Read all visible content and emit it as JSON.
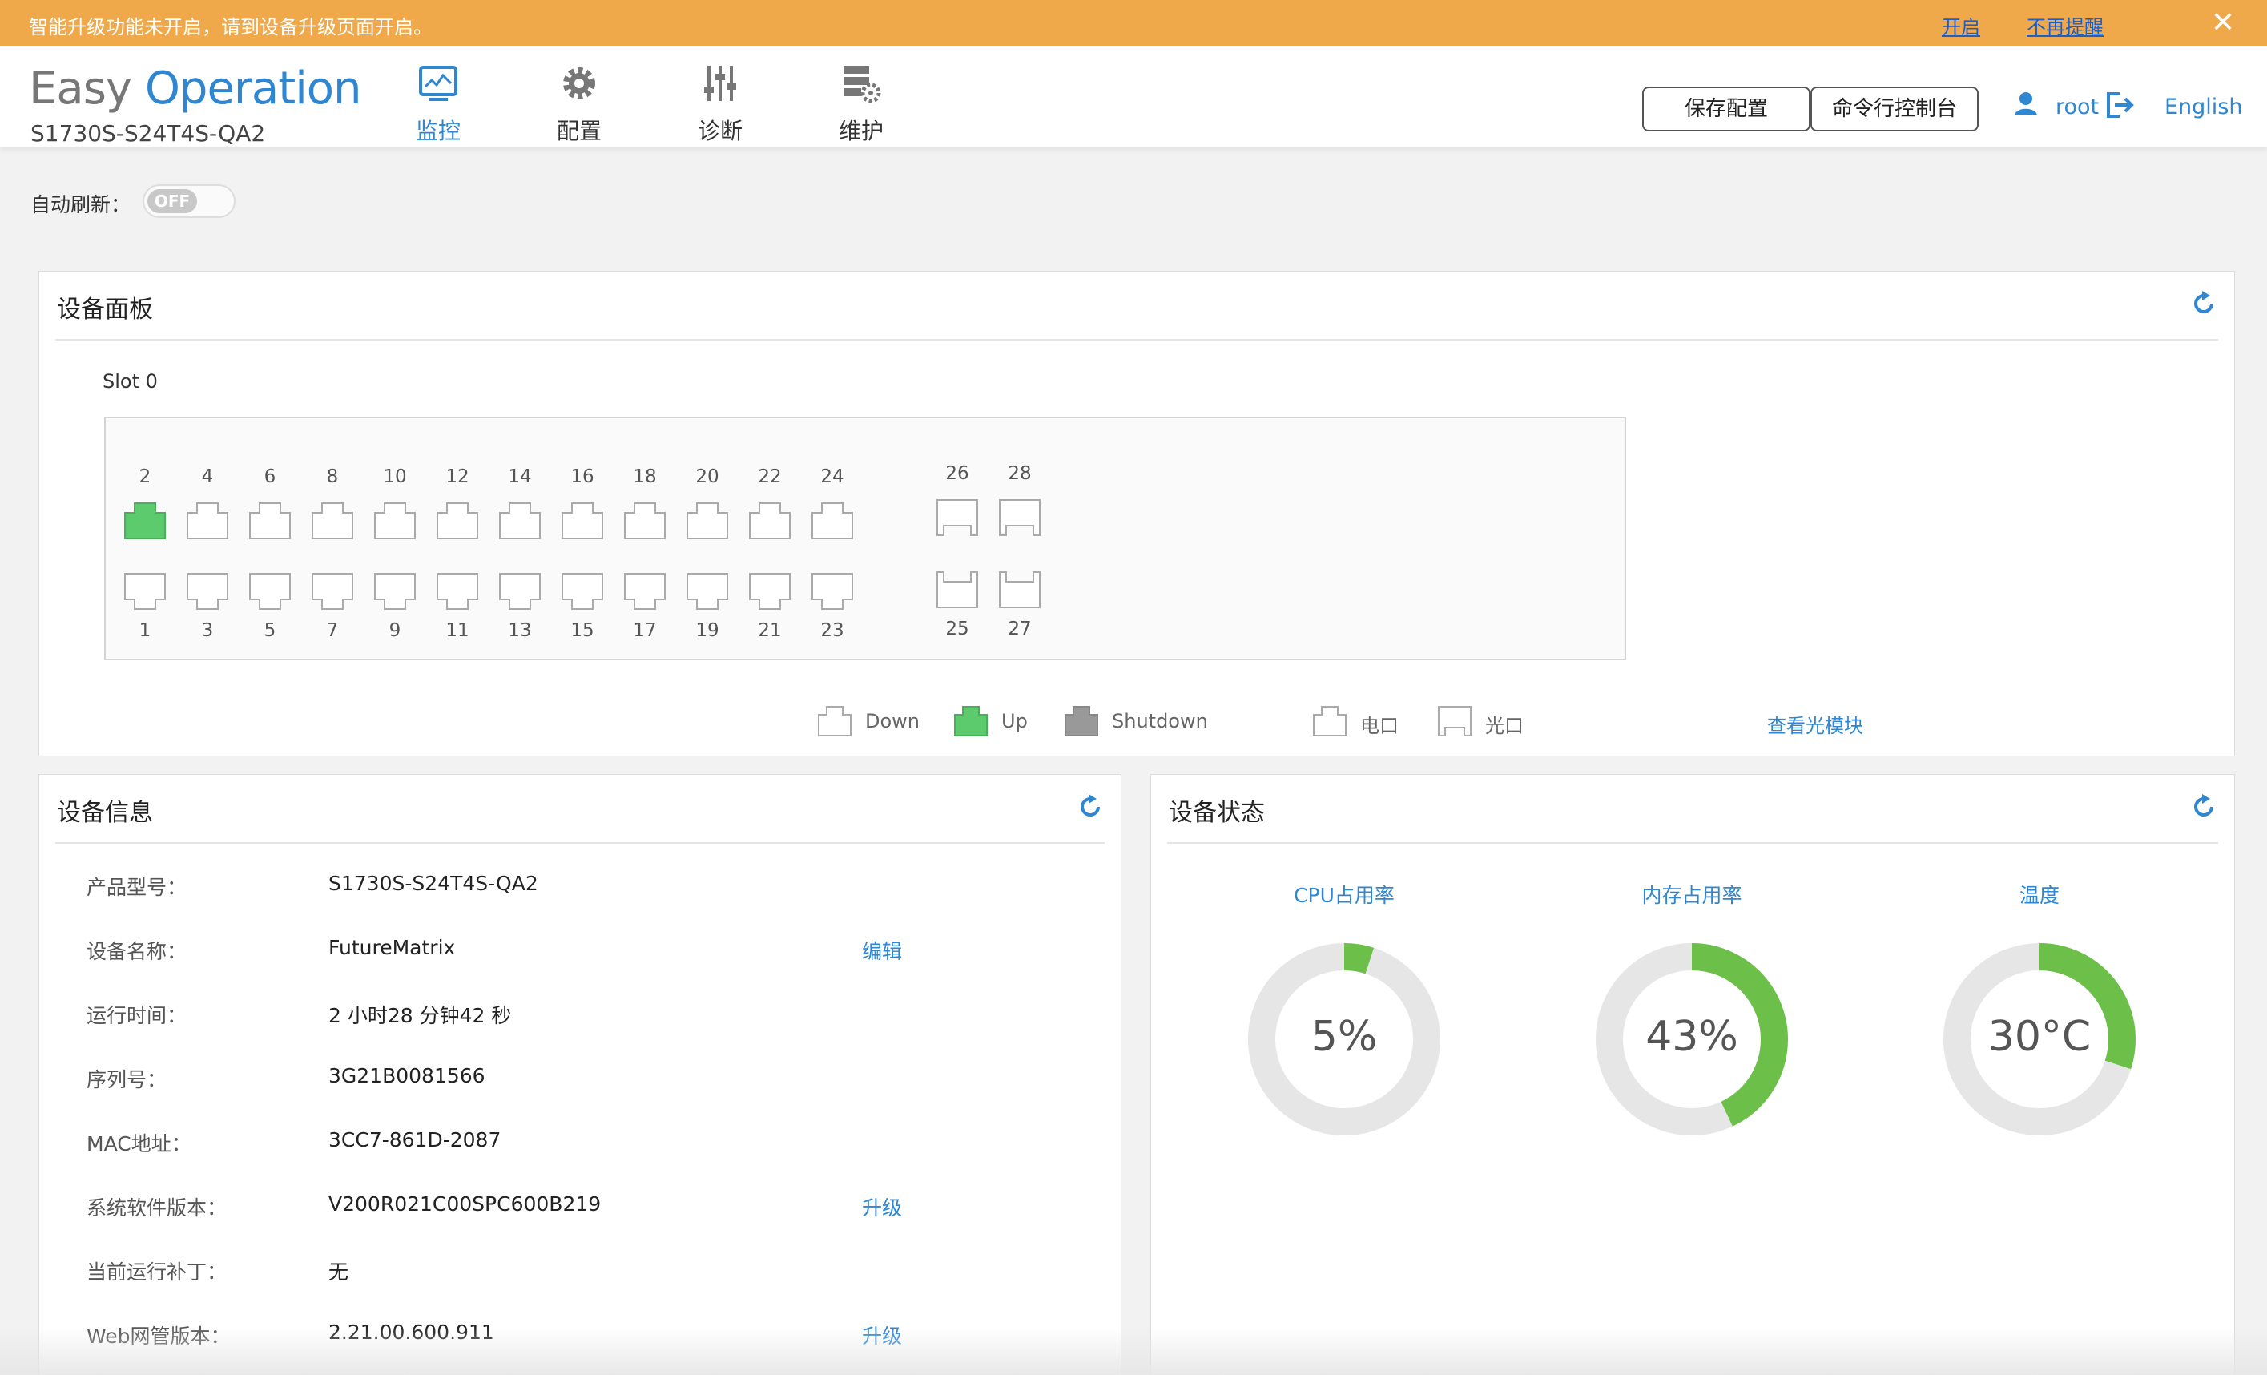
{
  "notice": {
    "message": "智能升级功能未开启，请到设备升级页面开启。",
    "enable_link": "开启",
    "dismiss_link": "不再提醒",
    "close": "✕"
  },
  "header": {
    "logo_part1": "Easy",
    "logo_part2": "Operation",
    "model": "S1730S-S24T4S-QA2",
    "nav": [
      {
        "label": "监控",
        "icon": "monitor-icon",
        "active": true
      },
      {
        "label": "配置",
        "icon": "gear-icon",
        "active": false
      },
      {
        "label": "诊断",
        "icon": "sliders-icon",
        "active": false
      },
      {
        "label": "维护",
        "icon": "maintenance-icon",
        "active": false
      }
    ],
    "save_config": "保存配置",
    "cli_console": "命令行控制台",
    "user": "root",
    "language": "English"
  },
  "auto_refresh": {
    "label": "自动刷新：",
    "state": "OFF"
  },
  "device_panel": {
    "title": "设备面板",
    "slot": "Slot 0",
    "top_ports": [
      "2",
      "4",
      "6",
      "8",
      "10",
      "12",
      "14",
      "16",
      "18",
      "20",
      "22",
      "24"
    ],
    "bottom_ports": [
      "1",
      "3",
      "5",
      "7",
      "9",
      "11",
      "13",
      "15",
      "17",
      "19",
      "21",
      "23"
    ],
    "sfp_top": [
      "26",
      "28"
    ],
    "sfp_bottom": [
      "25",
      "27"
    ],
    "up_ports": [
      "2"
    ],
    "legend": {
      "down": "Down",
      "up": "Up",
      "shutdown": "Shutdown",
      "electrical": "电口",
      "optical": "光口",
      "view_optical": "查看光模块"
    },
    "colors": {
      "up": "#5ccb6e",
      "shutdown": "#999999",
      "down": "#ffffff"
    }
  },
  "device_info": {
    "title": "设备信息",
    "rows": [
      {
        "label": "产品型号：",
        "value": "S1730S-S24T4S-QA2",
        "action": ""
      },
      {
        "label": "设备名称：",
        "value": "FutureMatrix",
        "action": "编辑"
      },
      {
        "label": "运行时间：",
        "value": "2 小时28 分钟42 秒",
        "action": ""
      },
      {
        "label": "序列号：",
        "value": "3G21B0081566",
        "action": ""
      },
      {
        "label": "MAC地址：",
        "value": "3CC7-861D-2087",
        "action": ""
      },
      {
        "label": "系统软件版本：",
        "value": "V200R021C00SPC600B219",
        "action": "升级"
      },
      {
        "label": "当前运行补丁：",
        "value": "无",
        "action": ""
      },
      {
        "label": "Web网管版本：",
        "value": "2.21.00.600.911",
        "action": "升级"
      }
    ]
  },
  "device_status": {
    "title": "设备状态",
    "gauges": [
      {
        "title": "CPU占用率",
        "display": "5%",
        "fraction": 0.05
      },
      {
        "title": "内存占用率",
        "display": "43%",
        "fraction": 0.43
      },
      {
        "title": "温度",
        "display": "30°C",
        "fraction": 0.3
      }
    ],
    "colors": {
      "fill": "#6cc04a",
      "track": "#e6e6e6"
    }
  }
}
